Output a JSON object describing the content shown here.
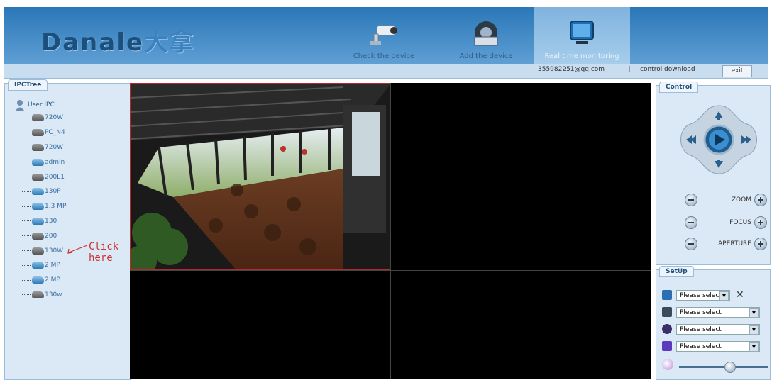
{
  "brand": {
    "name_en": "Danale",
    "name_cn": "大拿"
  },
  "nav": {
    "check_label": "Check the device",
    "add_label": "Add the device",
    "monitor_label": "Real time monitoring"
  },
  "subbar": {
    "email": "355982251@qq.com",
    "separator": "|",
    "control_download": "control download",
    "exit_label": "exit"
  },
  "tree": {
    "tab_label": "IPCTree",
    "root_label": "User IPC",
    "items": [
      {
        "label": "720W",
        "icon": "camera-gray"
      },
      {
        "label": "PC_N4",
        "icon": "camera-gray"
      },
      {
        "label": "720W",
        "icon": "camera-gray"
      },
      {
        "label": "admin",
        "icon": "camera-blue"
      },
      {
        "label": "200L1",
        "icon": "camera-gray"
      },
      {
        "label": "130P",
        "icon": "camera-blue"
      },
      {
        "label": "1.3 MP",
        "icon": "camera-blue"
      },
      {
        "label": "130",
        "icon": "camera-blue"
      },
      {
        "label": "200",
        "icon": "camera-gray"
      },
      {
        "label": "130W",
        "icon": "camera-gray"
      },
      {
        "label": "2 MP",
        "icon": "camera-blue"
      },
      {
        "label": "2 MP",
        "icon": "camera-blue"
      },
      {
        "label": "130w",
        "icon": "camera-gray"
      }
    ],
    "hint": "Click here"
  },
  "control": {
    "tab_label": "Control",
    "zoom": "ZOOM",
    "focus": "FOCUS",
    "aperture": "APERTURE"
  },
  "setup": {
    "tab_label": "SetUp",
    "selects": [
      {
        "value": "Please select",
        "icon": "layout-icon"
      },
      {
        "value": "Please select",
        "icon": "screen-icon"
      },
      {
        "value": "Please select",
        "icon": "face-icon"
      },
      {
        "value": "Please select",
        "icon": "sound-icon"
      }
    ]
  }
}
